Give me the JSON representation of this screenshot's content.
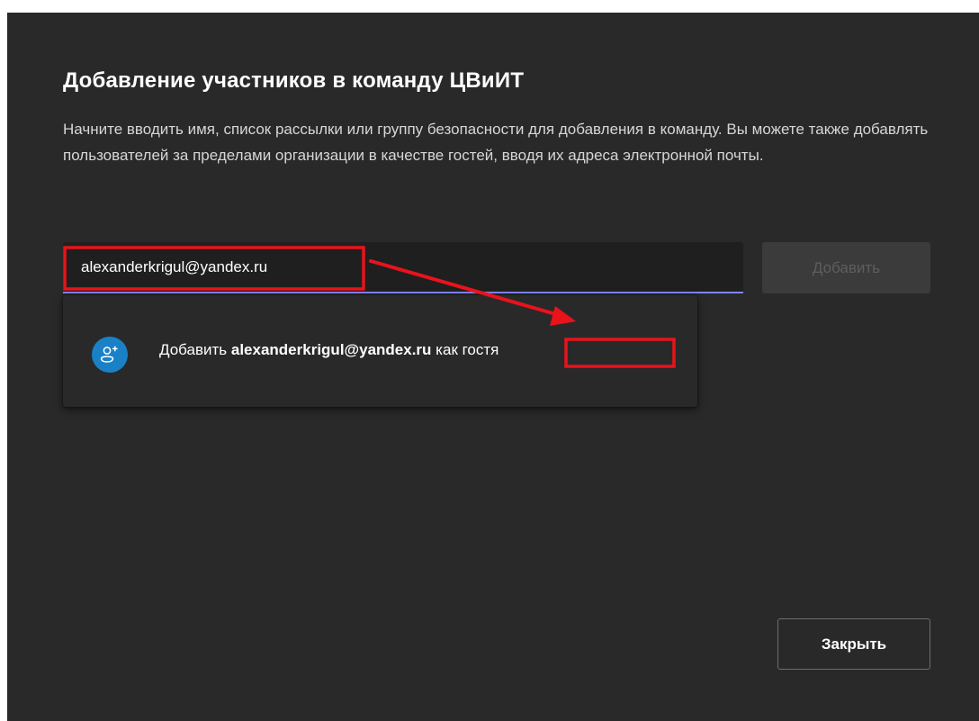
{
  "dialog": {
    "title": "Добавление участников в команду ЦВиИТ",
    "description": "Начните вводить имя, список рассылки или группу безопасности для добавления в команду. Вы можете также добавлять пользователей за пределами организации в качестве гостей, вводя их адреса электронной почты.",
    "input_value": "alexanderkrigul@yandex.ru",
    "add_button_label": "Добавить",
    "close_button_label": "Закрыть",
    "accent_color": "#7f85f5",
    "avatar_color": "#1a81c7",
    "annotation_color": "#e8131b"
  },
  "suggestion": {
    "prefix": "Добавить",
    "email": "alexanderkrigul@yandex.ru",
    "suffix": "как гостя",
    "icon": "add-person-icon"
  }
}
